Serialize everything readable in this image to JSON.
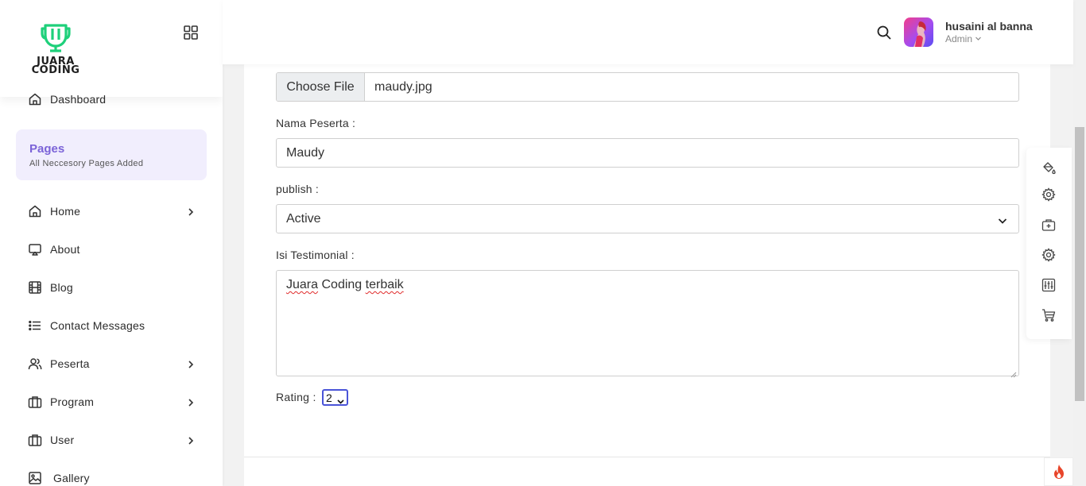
{
  "app": {
    "logo_text_line1": "JUARA",
    "logo_text_line2": "CODING",
    "brand_color": "#1ed07a",
    "accent_color": "#7b63d8"
  },
  "sidebar": {
    "top_item": {
      "label": "Dashboard",
      "icon": "home-icon"
    },
    "pages_section": {
      "title": "Pages",
      "subtitle": "All Neccesory Pages Added"
    },
    "items": [
      {
        "label": "Home",
        "icon": "home-icon",
        "has_submenu": true
      },
      {
        "label": "About",
        "icon": "monitor-icon",
        "has_submenu": false
      },
      {
        "label": "Blog",
        "icon": "film-icon",
        "has_submenu": false
      },
      {
        "label": "Contact Messages",
        "icon": "list-icon",
        "has_submenu": false
      },
      {
        "label": "Peserta",
        "icon": "users-icon",
        "has_submenu": true
      },
      {
        "label": "Program",
        "icon": "briefcase-icon",
        "has_submenu": true
      },
      {
        "label": "User",
        "icon": "briefcase-icon",
        "has_submenu": true
      },
      {
        "label": "Gallery",
        "icon": "image-icon",
        "has_submenu": false
      }
    ]
  },
  "header": {
    "user_name": "husaini al banna",
    "user_role": "Admin"
  },
  "form": {
    "file_button_label": "Choose File",
    "file_name": "maudy.jpg",
    "nama_label": "Nama Peserta :",
    "nama_value": "Maudy",
    "publish_label": "publish :",
    "publish_value": "Active",
    "isi_label": "Isi Testimonial :",
    "isi_value_words": [
      "Juara",
      "Coding",
      "terbaik"
    ],
    "rating_label": "Rating :",
    "rating_value": "2"
  },
  "right_panel": {
    "icons": [
      "paint-bucket-icon",
      "gear-icon",
      "briefcase-plus-icon",
      "gear-icon",
      "sliders-icon",
      "cart-icon"
    ]
  }
}
